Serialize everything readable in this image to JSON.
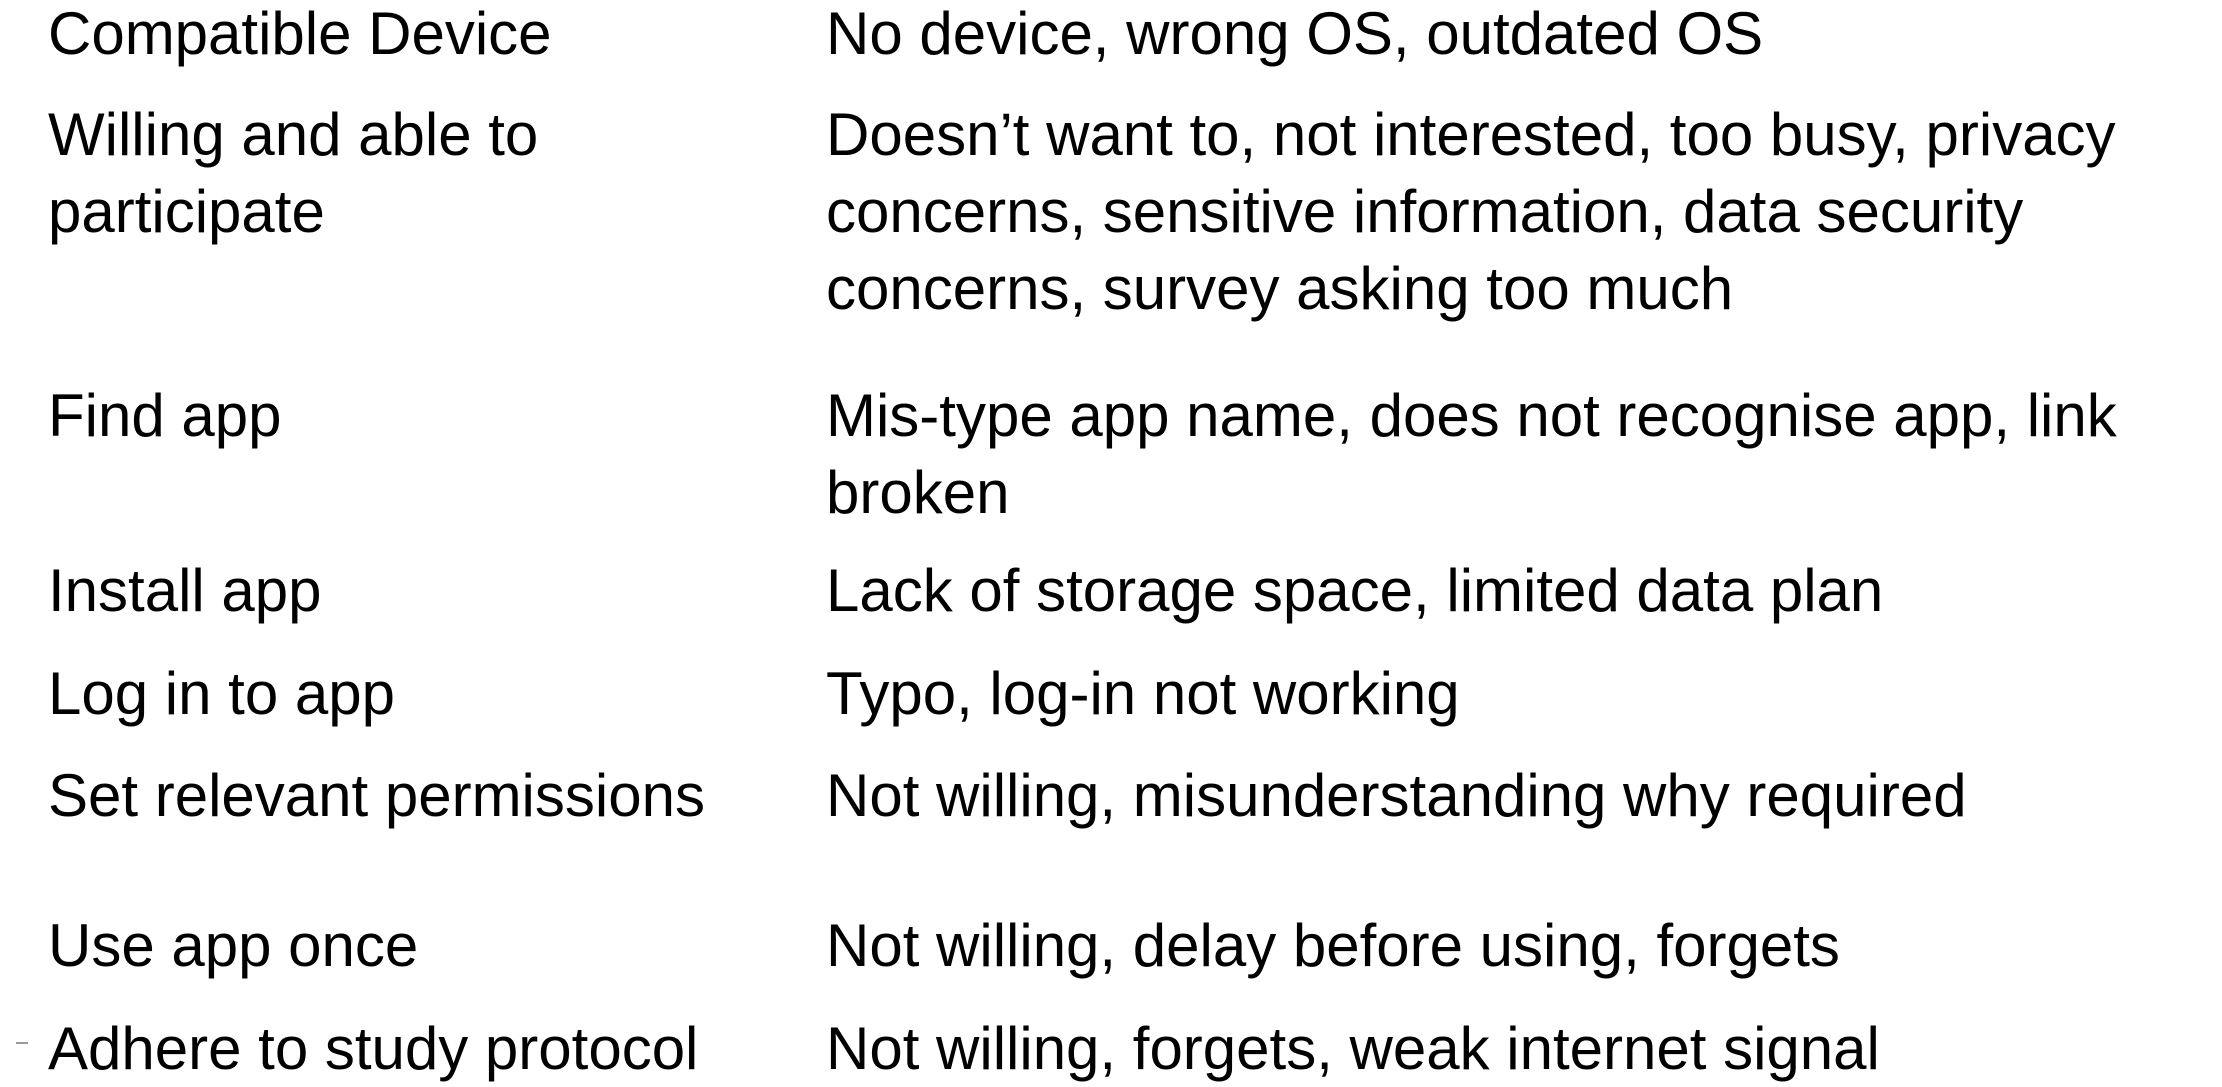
{
  "rows": [
    {
      "step": "Compatible Device",
      "barrier_lines": [
        "No device, wrong OS, outdated OS"
      ]
    },
    {
      "step_lines": [
        "Willing and able to",
        "participate"
      ],
      "barrier_lines": [
        "Doesn’t want to, not interested, too busy, privacy",
        "concerns, sensitive information, data security",
        "concerns, survey asking too much"
      ]
    },
    {
      "step": "Find app",
      "barrier_lines": [
        "Mis-type app name, does not recognise app, link",
        "broken"
      ]
    },
    {
      "step": "Install app",
      "barrier_lines": [
        "Lack of storage space, limited data plan"
      ]
    },
    {
      "step": "Log in to app",
      "barrier_lines": [
        "Typo, log-in not working"
      ]
    },
    {
      "step": "Set relevant permissions",
      "barrier_lines": [
        "Not willing, misunderstanding why required"
      ]
    },
    {
      "step": "Use app once",
      "barrier_lines": [
        "Not willing, delay before using, forgets"
      ]
    },
    {
      "step": "Adhere to study protocol",
      "barrier_lines": [
        "Not willing, forgets, weak internet signal"
      ]
    }
  ]
}
